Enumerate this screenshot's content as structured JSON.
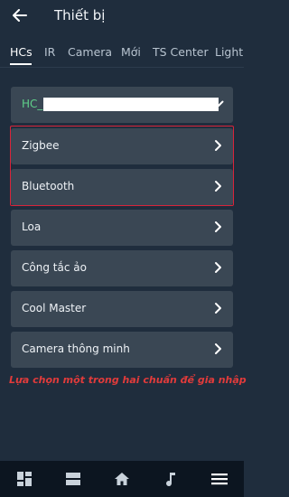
{
  "header": {
    "title": "Thiết bị"
  },
  "tabs": [
    {
      "label": "HCs",
      "active": true
    },
    {
      "label": "IR"
    },
    {
      "label": "Camera"
    },
    {
      "label": "Mới"
    },
    {
      "label": "TS Center"
    },
    {
      "label": "Lighting"
    }
  ],
  "hc_select": {
    "value": "HC_"
  },
  "device_types": [
    {
      "label": "Zigbee"
    },
    {
      "label": "Bluetooth"
    },
    {
      "label": "Loa"
    },
    {
      "label": "Công tắc ảo"
    },
    {
      "label": "Cool Master"
    },
    {
      "label": "Camera thông minh"
    }
  ],
  "annotation": {
    "text": "Lựa chọn một trong hai chuẩn để gia nhập",
    "color": "#e03b3b"
  },
  "colors": {
    "background": "#1f2d3d",
    "card": "#3a4754",
    "accent_green": "#5fd08a",
    "highlight_red": "#d9243a",
    "bottom_bar": "#0c1520"
  },
  "bottom_nav": [
    {
      "icon": "dashboard-icon"
    },
    {
      "icon": "list-view-icon"
    },
    {
      "icon": "home-icon"
    },
    {
      "icon": "music-note-icon"
    },
    {
      "icon": "menu-icon"
    }
  ]
}
